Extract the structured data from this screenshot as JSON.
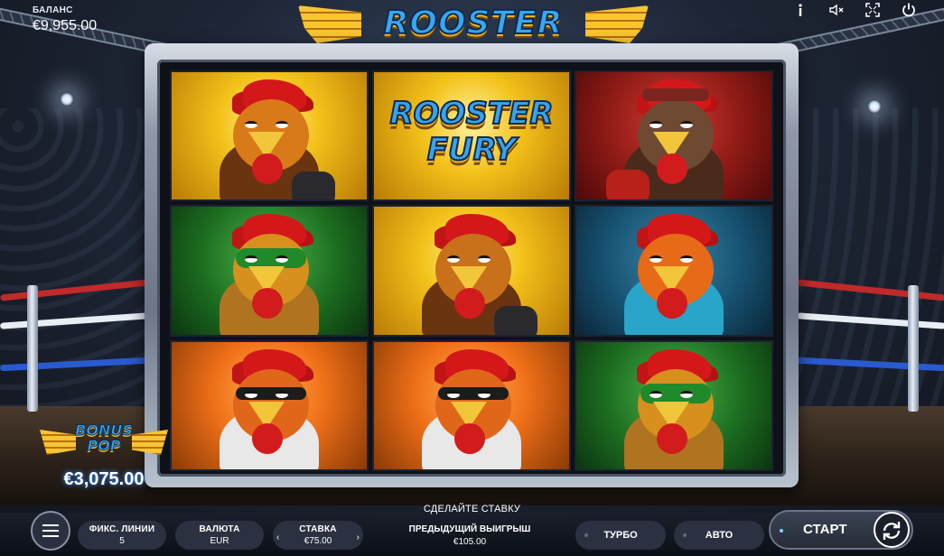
{
  "game": {
    "logo": "ROOSTER FURY"
  },
  "balance": {
    "label": "БАЛАНС",
    "value": "€9,955.00"
  },
  "top_icons": [
    "info-icon",
    "sound-muted-icon",
    "fullscreen-icon",
    "power-icon"
  ],
  "reels": [
    [
      {
        "symbol": "rooster-boxer",
        "bg": "gold"
      },
      {
        "symbol": "rooster-masked",
        "bg": "green"
      },
      {
        "symbol": "rooster-orange",
        "bg": "orange"
      }
    ],
    [
      {
        "symbol": "logo",
        "bg": "gold",
        "text": "ROOSTER FURY"
      },
      {
        "symbol": "rooster-boxer",
        "bg": "gold"
      },
      {
        "symbol": "rooster-orange",
        "bg": "orange"
      }
    ],
    [
      {
        "symbol": "rooster-headband",
        "bg": "red"
      },
      {
        "symbol": "rooster-helmet",
        "bg": "blue"
      },
      {
        "symbol": "rooster-masked",
        "bg": "green"
      }
    ]
  ],
  "bonus": {
    "title": "BONUS POP",
    "value": "€3,075.00"
  },
  "controls": {
    "prompt": "СДЕЛАЙТЕ СТАВКУ",
    "lines_label": "ФИКС. ЛИНИИ",
    "lines_value": "5",
    "currency_label": "ВАЛЮТА",
    "currency_value": "EUR",
    "stake_label": "СТАВКА",
    "stake_value": "€75.00",
    "prev_win_label": "ПРЕДЫДУЩИЙ ВЫИГРЫШ",
    "prev_win_value": "€105.00",
    "turbo_label": "ТУРБО",
    "auto_label": "АВТО",
    "start_label": "СТАРТ"
  },
  "colors": {
    "accent": "#39a7ee",
    "gold": "#f5b81d",
    "bar": "#1a1f2b"
  }
}
